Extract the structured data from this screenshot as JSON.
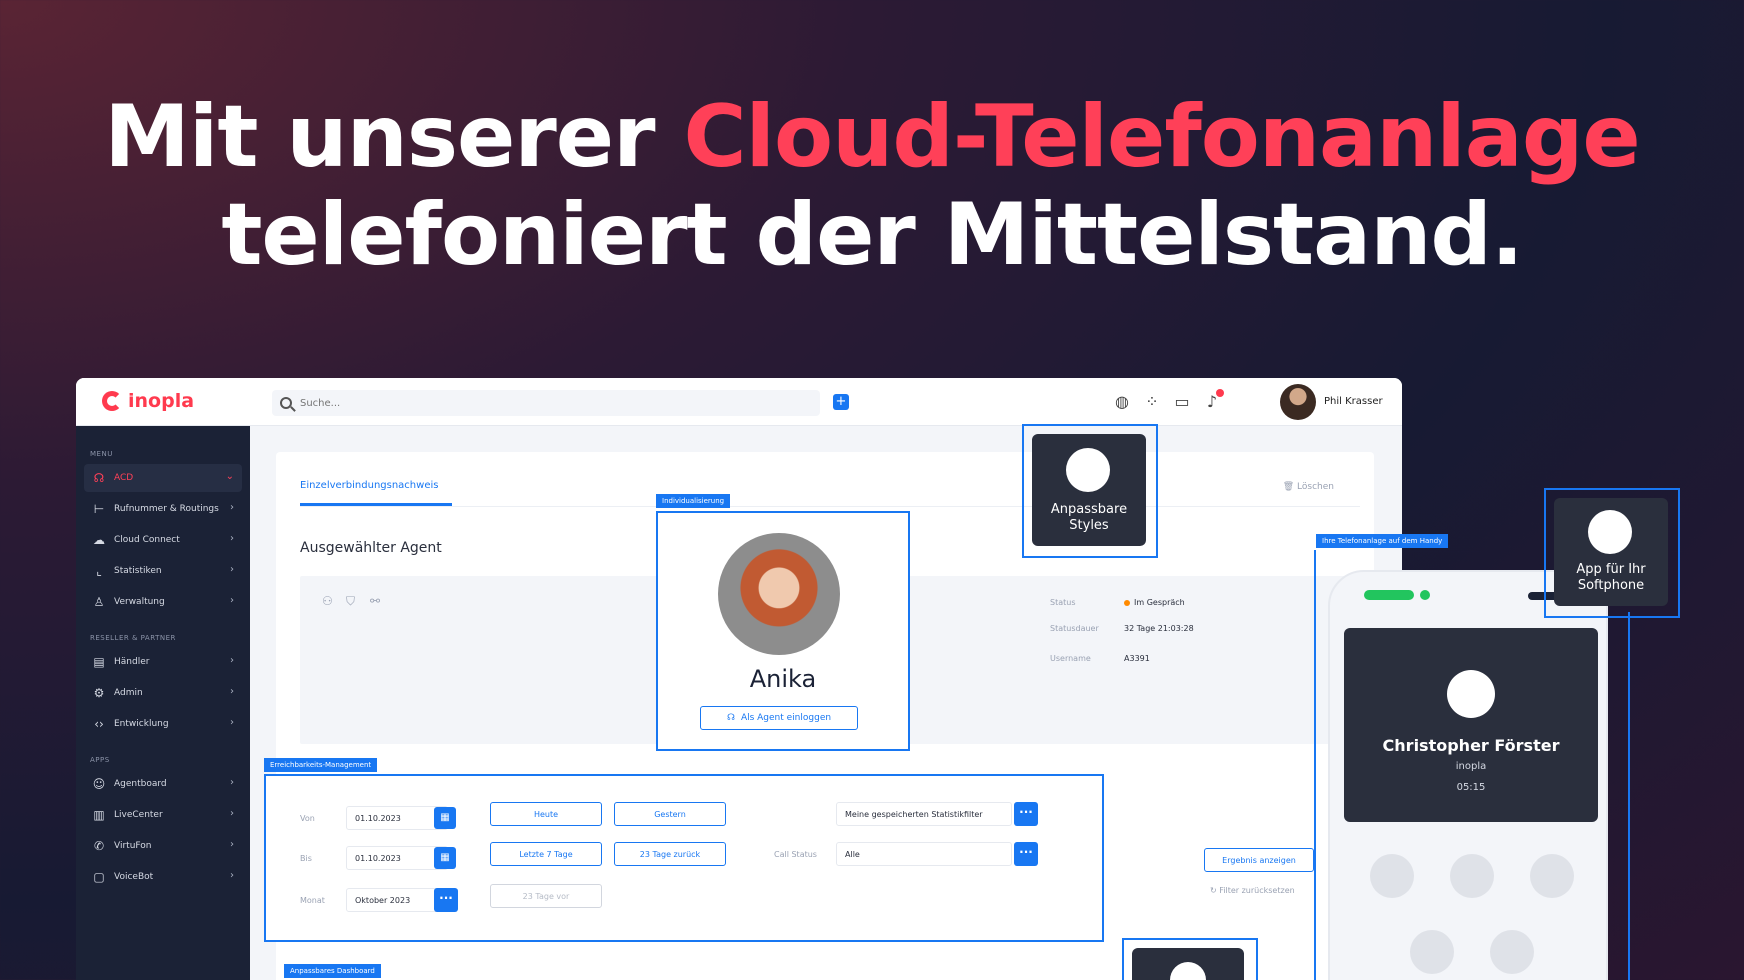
{
  "headline": {
    "line1_prefix": "Mit unserer ",
    "line1_accent": "Cloud-Telefonanlage",
    "line2": "telefoniert der Mittelstand."
  },
  "colors": {
    "accent": "#ff4058",
    "primary": "#1877f2",
    "sidebar": "#1b2236"
  },
  "app": {
    "logo": "inopla",
    "search": {
      "placeholder": "Suche..."
    },
    "topbar_icons": [
      "globe-icon",
      "apps-grid-icon",
      "chat-icon",
      "bell-icon"
    ],
    "user": {
      "name": "Phil Krasser"
    }
  },
  "sidebar": {
    "menu_header": "MENU",
    "menu_items": [
      {
        "label": "ACD",
        "icon": "headset-icon",
        "active": true
      },
      {
        "label": "Rufnummer & Routings",
        "icon": "routing-icon"
      },
      {
        "label": "Cloud Connect",
        "icon": "cloud-icon"
      },
      {
        "label": "Statistiken",
        "icon": "chart-icon"
      },
      {
        "label": "Verwaltung",
        "icon": "user-icon"
      }
    ],
    "reseller_header": "RESELLER & PARTNER",
    "reseller_items": [
      {
        "label": "Händler",
        "icon": "store-icon"
      },
      {
        "label": "Admin",
        "icon": "admin-icon"
      },
      {
        "label": "Entwicklung",
        "icon": "code-icon"
      }
    ],
    "apps_header": "APPS",
    "apps_items": [
      {
        "label": "Agentboard",
        "icon": "agent-icon"
      },
      {
        "label": "LiveCenter",
        "icon": "live-chart-icon"
      },
      {
        "label": "VirtuFon",
        "icon": "phone-icon"
      },
      {
        "label": "VoiceBot",
        "icon": "bot-icon"
      }
    ]
  },
  "main": {
    "tab": "Einzelverbindungsnachweis",
    "delete_label": "Löschen",
    "agent_title": "Ausgewählter Agent",
    "info": {
      "status_label": "Status",
      "status_value": "Im Gespräch",
      "duration_label": "Statusdauer",
      "duration_value": "32 Tage 21:03:28",
      "username_label": "Username",
      "username_value": "A3391"
    }
  },
  "profile": {
    "tag": "Individualisierung",
    "name": "Anika",
    "login_button": "Als Agent einloggen"
  },
  "styles_card": {
    "label_line1": "Anpassbare",
    "label_line2": "Styles"
  },
  "filters": {
    "tag": "Erreichbarkeits-Management",
    "from_label": "Von",
    "from_value": "01.10.2023",
    "to_label": "Bis",
    "to_value": "01.10.2023",
    "month_label": "Monat",
    "month_value": "Oktober 2023",
    "today": "Heute",
    "yesterday": "Gestern",
    "last7": "Letzte 7 Tage",
    "back23": "23 Tage zurück",
    "fwd23": "23 Tage vor",
    "saved_filters": "Meine gespeicherten Statistikfilter",
    "call_status_label": "Call Status",
    "call_status_value": "Alle",
    "result_button": "Ergebnis anzeigen",
    "reset_label": "Filter zurücksetzen"
  },
  "dashboard_tag": "Anpassbares Dashboard",
  "phone": {
    "tag": "Ihre Telefonanlage auf dem Handy",
    "caller_name": "Christopher Förster",
    "caller_company": "inopla",
    "call_time": "05:15"
  },
  "softphone_card": {
    "label_line1": "App für Ihr",
    "label_line2": "Softphone"
  }
}
